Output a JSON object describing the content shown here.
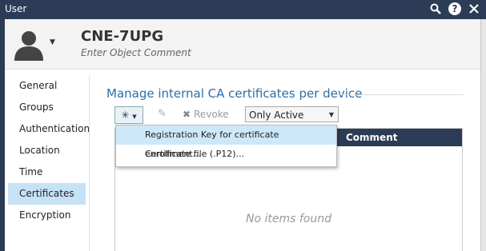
{
  "window": {
    "title": "User"
  },
  "header": {
    "object_name": "CNE-7UPG",
    "comment_placeholder": "Enter Object Comment"
  },
  "nav": {
    "items": [
      {
        "label": "General"
      },
      {
        "label": "Groups"
      },
      {
        "label": "Authentication"
      },
      {
        "label": "Location"
      },
      {
        "label": "Time"
      },
      {
        "label": "Certificates",
        "active": true
      },
      {
        "label": "Encryption"
      }
    ]
  },
  "section": {
    "title": "Manage internal CA certificates per device"
  },
  "toolbar": {
    "new_symbol": "✳",
    "revoke_label": "Revoke",
    "filter_selected": "Only Active"
  },
  "new_menu": {
    "items": [
      {
        "label": "Registration Key for certificate enrollment..."
      },
      {
        "label": "Certificate file (.P12)..."
      }
    ]
  },
  "grid": {
    "columns": [
      "Comment"
    ],
    "empty_text": "No items found"
  }
}
